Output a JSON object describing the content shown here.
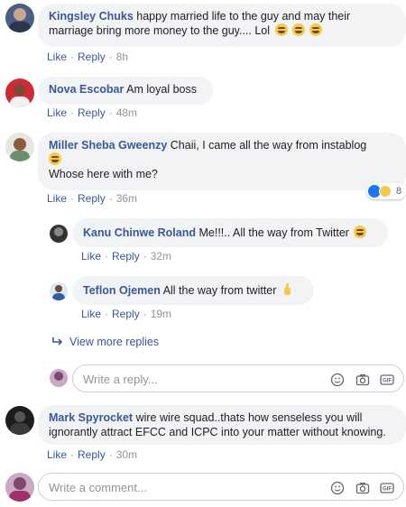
{
  "comments": [
    {
      "author": "Kingsley Chuks",
      "text": "happy married life to the guy and may their marriage bring more money to the guy.... Lol",
      "like": "Like",
      "reply": "Reply",
      "time": "8h"
    },
    {
      "author": "Nova Escobar",
      "text": "Am loyal boss",
      "like": "Like",
      "reply": "Reply",
      "time": "48m"
    },
    {
      "author": "Miller Sheba Gweenzy",
      "text_line1": "Chaii, I came all the way from instablog",
      "text_line2": "Whose here with me?",
      "like": "Like",
      "reply": "Reply",
      "time": "36m",
      "reaction_count": "8"
    },
    {
      "author": "Mark Spyrocket",
      "text": "wire wire squad..thats how senseless you will ignorantly attract EFCC and ICPC into your matter without knowing.",
      "like": "Like",
      "reply": "Reply",
      "time": "30m"
    }
  ],
  "replies": [
    {
      "author": "Kanu Chinwe Roland",
      "text": "Me!!!.. All the way from Twitter",
      "like": "Like",
      "reply": "Reply",
      "time": "32m"
    },
    {
      "author": "Teflon Ojemen",
      "text": "All the way from twitter",
      "like": "Like",
      "reply": "Reply",
      "time": "19m"
    }
  ],
  "view_more_replies": "View more replies",
  "reply_input": {
    "placeholder": "Write a reply..."
  },
  "comment_input": {
    "placeholder": "Write a comment..."
  },
  "colors": {
    "link": "#385898",
    "bubble": "#f2f3f5",
    "meta": "#90949c"
  }
}
